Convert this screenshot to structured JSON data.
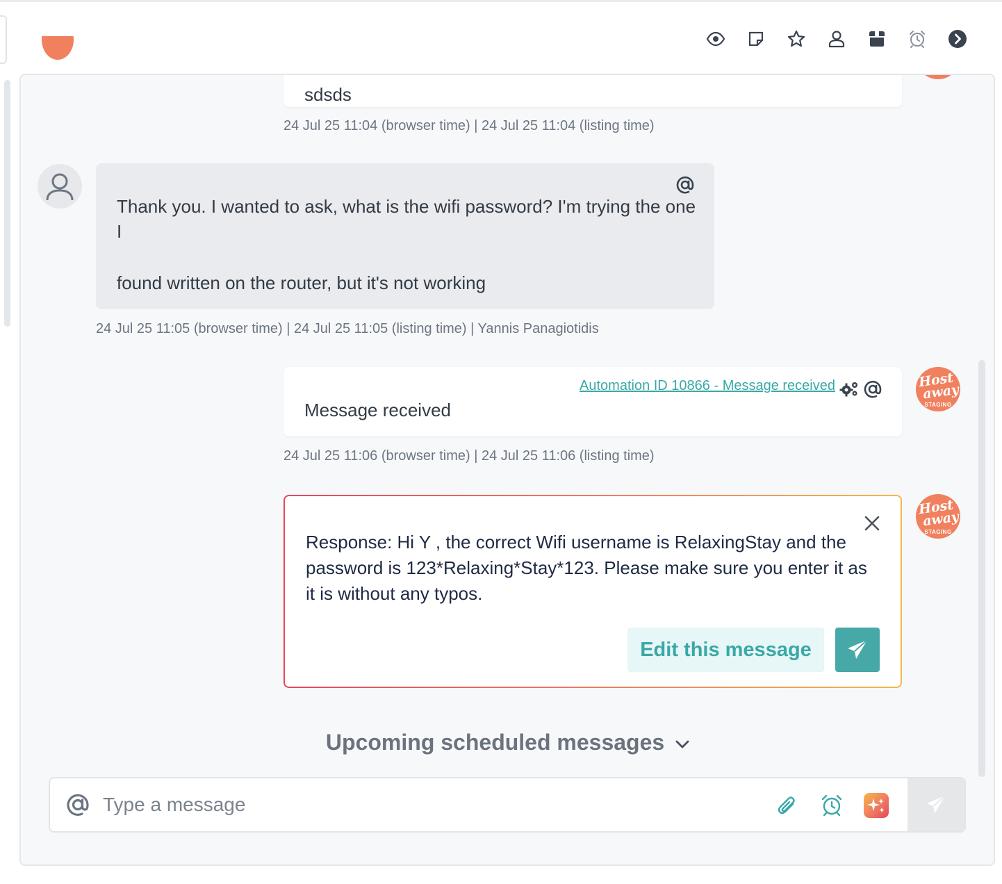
{
  "toolbar": {
    "icons": [
      "eye-icon",
      "note-icon",
      "star-icon",
      "user-icon",
      "archive-icon",
      "alarm-clock-icon",
      "chevron-right-circle-icon"
    ]
  },
  "messages": {
    "first": {
      "text": "sdsds",
      "meta": "24 Jul 25 11:04 (browser time) | 24 Jul 25 11:04 (listing time)"
    },
    "guest": {
      "line1": "Thank you. I wanted to ask, what is the wifi password? I'm trying the one I",
      "line2": "found written on the router, but it's not working",
      "meta": "24 Jul 25 11:05 (browser time) | 24 Jul 25 11:05 (listing time) | Yannis Panagiotidis"
    },
    "automation": {
      "link": "Automation ID 10866 - Message received",
      "text": "Message received",
      "meta": "24 Jul 25 11:06 (browser time) | 24 Jul 25 11:06 (listing time)"
    },
    "response": {
      "text": "Response: Hi Y      , the correct Wifi username is RelaxingStay and the password is 123*Relaxing*Stay*123. Please make sure you enter it as it is without any typos.",
      "edit_label": "Edit this message"
    }
  },
  "host_avatar": {
    "line1": "Host",
    "line2": "away",
    "line3": "STAGING"
  },
  "upcoming": {
    "label": "Upcoming scheduled messages"
  },
  "composer": {
    "placeholder": "Type a message"
  },
  "colors": {
    "accent": "#47a9a7",
    "host_avatar": "#f0805e",
    "gradient_start": "#e3475f",
    "gradient_end": "#f6b64a"
  }
}
